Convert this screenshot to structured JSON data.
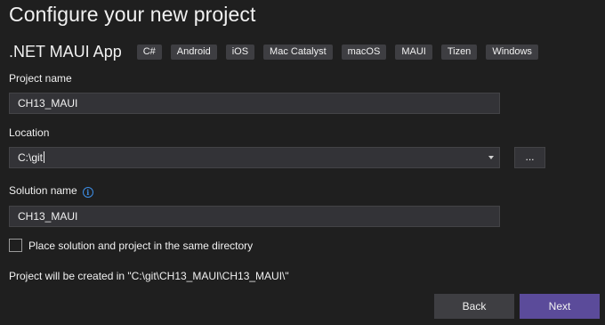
{
  "page": {
    "title": "Configure your new project"
  },
  "template": {
    "name": ".NET MAUI App",
    "tags": [
      "C#",
      "Android",
      "iOS",
      "Mac Catalyst",
      "macOS",
      "MAUI",
      "Tizen",
      "Windows"
    ]
  },
  "project_name": {
    "label": "Project name",
    "value": "CH13_MAUI"
  },
  "location": {
    "label": "Location",
    "value": "C:\\git",
    "browse_label": "..."
  },
  "solution_name": {
    "label": "Solution name",
    "value": "CH13_MAUI"
  },
  "same_directory": {
    "label": "Place solution and project in the same directory",
    "checked": false
  },
  "path_info": "Project will be created in \"C:\\git\\CH13_MAUI\\CH13_MAUI\\\"",
  "buttons": {
    "back": "Back",
    "next": "Next"
  },
  "colors": {
    "background": "#1f1f1f",
    "accent": "#5b4b9a",
    "info": "#3d8ee6"
  }
}
